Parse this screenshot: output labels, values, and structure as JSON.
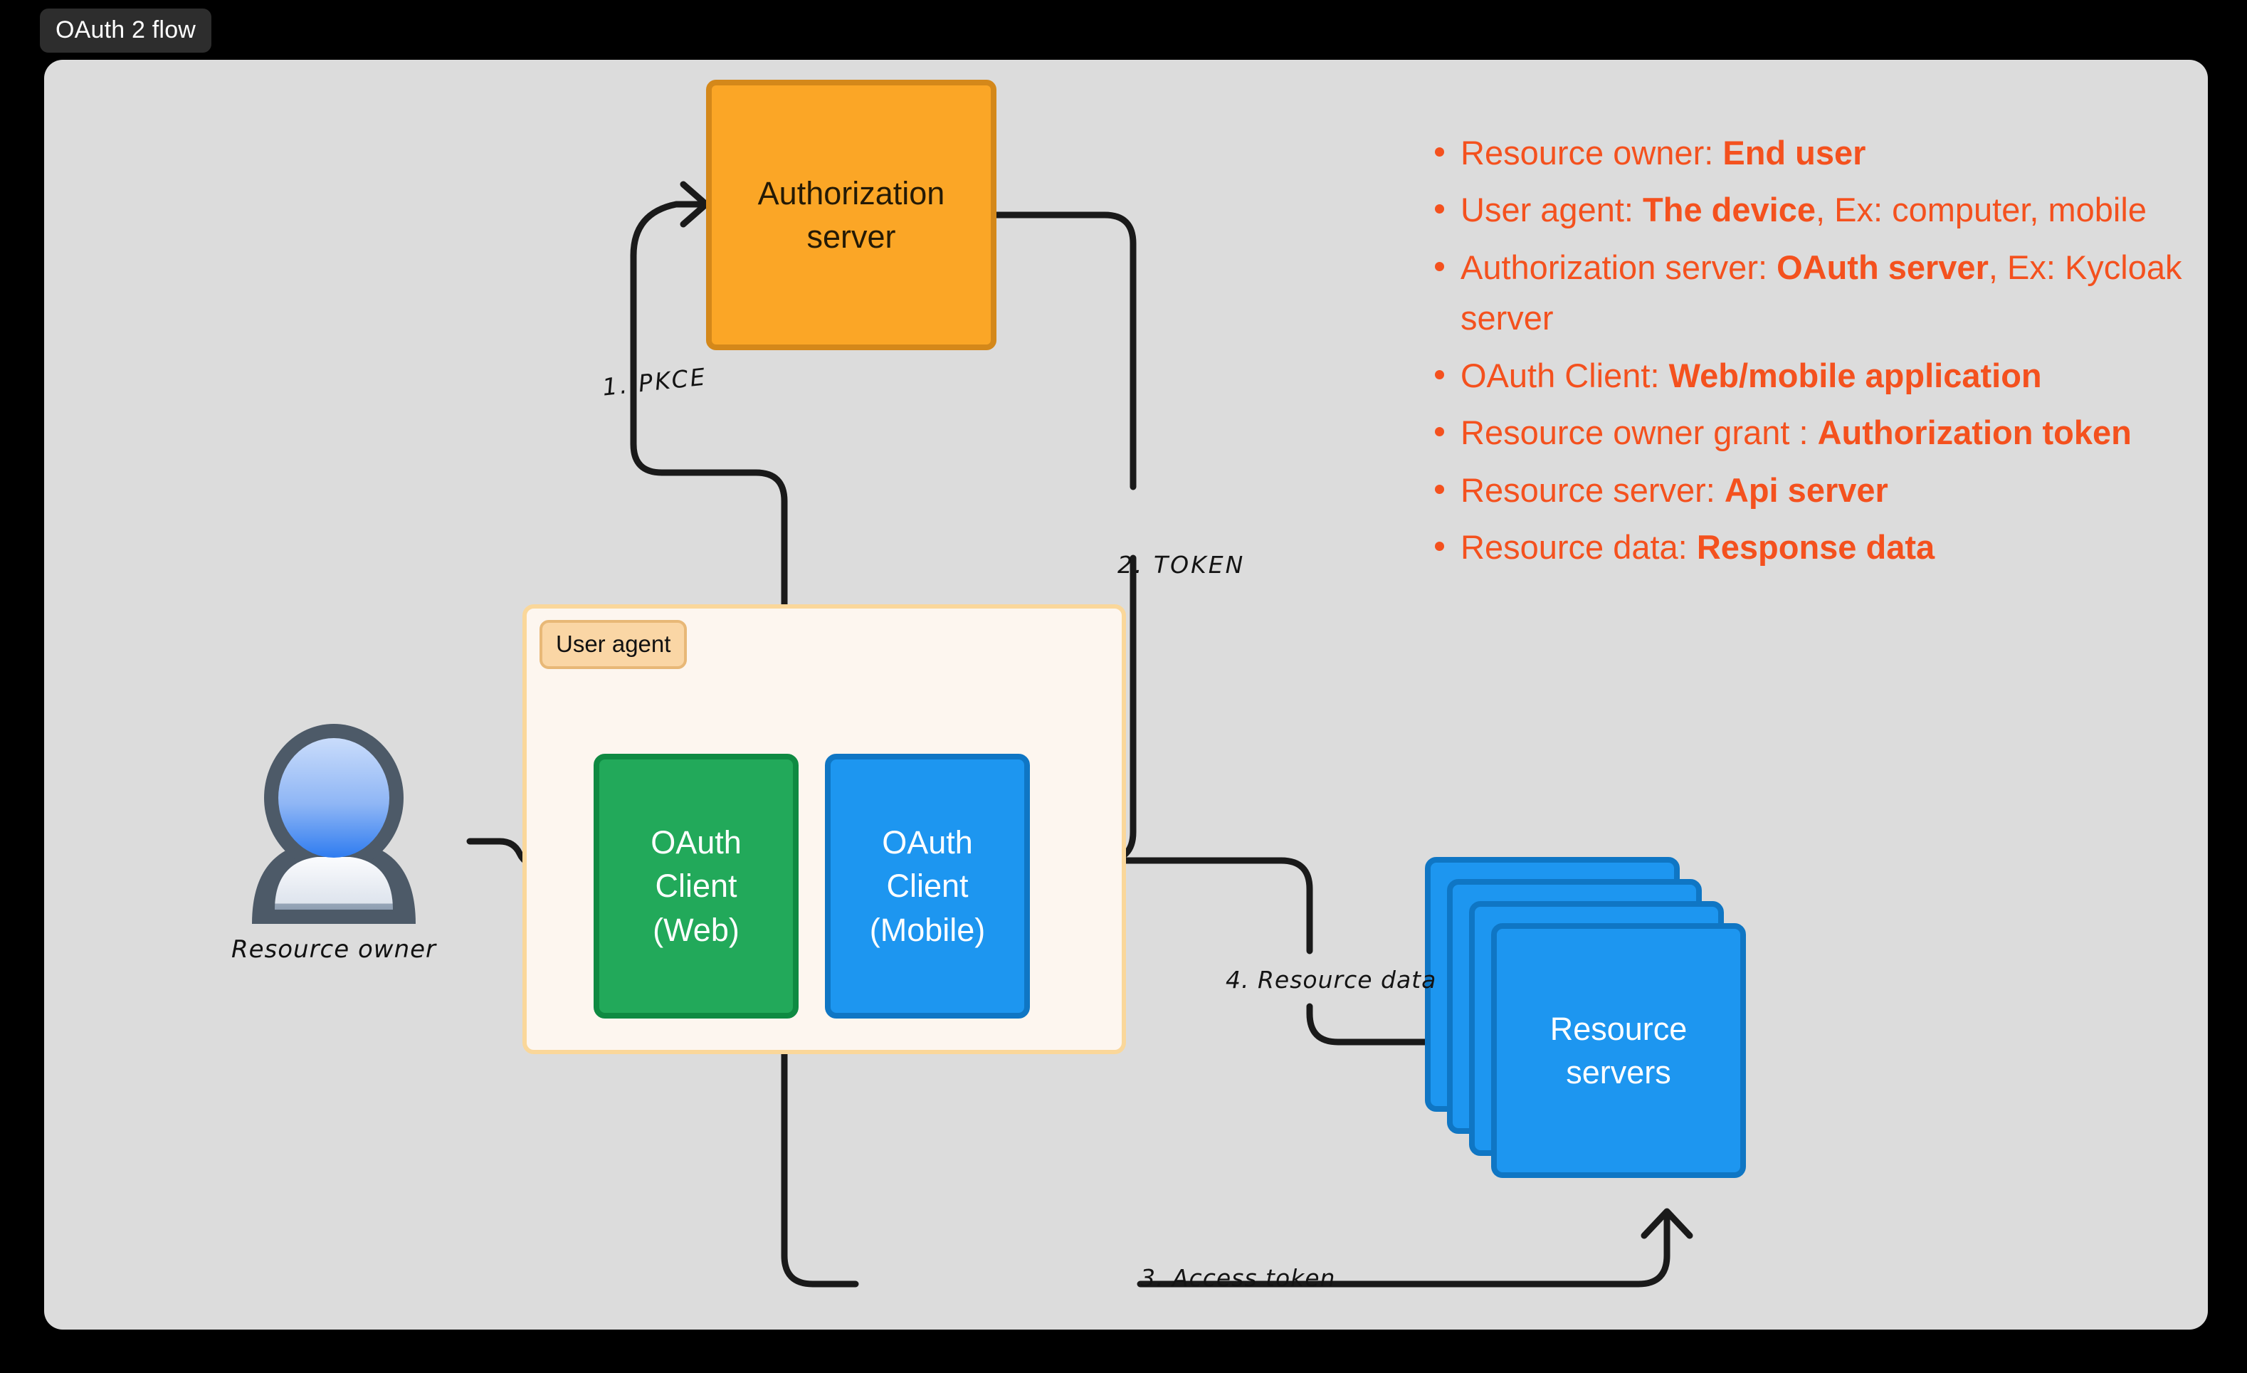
{
  "window": {
    "title": "OAuth 2 flow"
  },
  "diagram": {
    "nodes": {
      "auth_server": "Authorization\nserver",
      "user_agent_badge": "User agent",
      "oauth_client_web": "OAuth\nClient\n(Web)",
      "oauth_client_mobile": "OAuth\nClient\n(Mobile)",
      "resource_servers": "Resource\nservers",
      "resource_owner": "Resource owner"
    },
    "edges": [
      {
        "id": "pkce",
        "label": "1. PKCE",
        "from": "user-agent",
        "to": "auth-server"
      },
      {
        "id": "token",
        "label": "2. TOKEN",
        "from": "auth-server",
        "to": "user-agent"
      },
      {
        "id": "access-token",
        "label": "3. Access token",
        "from": "user-agent",
        "to": "resource-servers"
      },
      {
        "id": "resource-data",
        "label": "4. Resource data",
        "from": "resource-servers",
        "to": "user-agent"
      }
    ]
  },
  "legend": {
    "items": [
      {
        "prefix": "Resource owner: ",
        "strong": "End user",
        "suffix": ""
      },
      {
        "prefix": "User agent: ",
        "strong": "The device",
        "suffix": ", Ex: computer, mobile"
      },
      {
        "prefix": "Authorization server: ",
        "strong": "OAuth server",
        "suffix": ", Ex: Kycloak server"
      },
      {
        "prefix": "OAuth Client: ",
        "strong": "Web/mobile application",
        "suffix": ""
      },
      {
        "prefix": "Resource owner grant :  ",
        "strong": "Authorization token",
        "suffix": ""
      },
      {
        "prefix": "Resource server: ",
        "strong": "Api server",
        "suffix": ""
      },
      {
        "prefix": "Resource data: ",
        "strong": "Response data",
        "suffix": ""
      }
    ]
  },
  "colors": {
    "canvas_bg": "#dcdcdc",
    "page_bg": "#000000",
    "title_tab_bg": "#2d2d2d",
    "auth_server_fill": "#fba626",
    "auth_server_border": "#d4881a",
    "client_web_fill": "#22a95a",
    "client_web_border": "#0e8a42",
    "client_mobile_fill": "#1d96f0",
    "client_mobile_border": "#0f76c4",
    "user_agent_fill": "#fdf6ef",
    "user_agent_border": "#fad79a",
    "user_agent_badge_fill": "#fad6a5",
    "legend_text": "#f4511e",
    "wire": "#1a1a1a"
  }
}
